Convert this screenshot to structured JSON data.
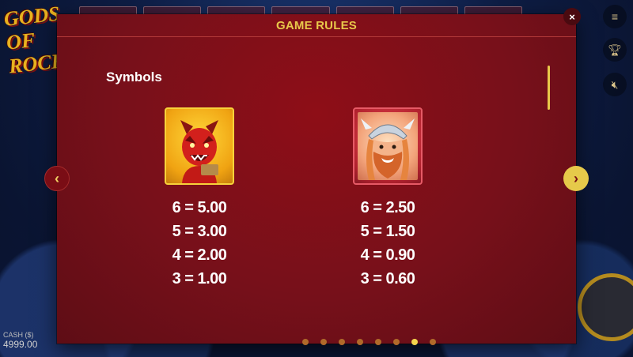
{
  "modal": {
    "title": "GAME RULES",
    "close_label": "×",
    "section_heading": "Symbols"
  },
  "background": {
    "logo": "GODS OF ROCK",
    "cash_label": "CASH ($)",
    "cash_value": "4999.00"
  },
  "symbols": [
    {
      "name": "devil-symbol",
      "icon": "devil-icon",
      "payouts": [
        "6 = 5.00",
        "5 = 3.00",
        "4 = 2.00",
        "3 = 1.00"
      ]
    },
    {
      "name": "thor-symbol",
      "icon": "viking-icon",
      "payouts": [
        "6 = 2.50",
        "5 = 1.50",
        "4 = 0.90",
        "3 = 0.60"
      ]
    }
  ],
  "navigation": {
    "prev_label": "‹",
    "next_label": "›"
  },
  "pagination": {
    "page_count": 8,
    "active_page": 7
  },
  "side_menu": {
    "icons": [
      "menu-icon",
      "trophy-icon",
      "mute-icon"
    ]
  },
  "colors": {
    "modal_bg": "#77101a",
    "title": "#e8c84a",
    "accent_gold": "#f4d54d"
  }
}
